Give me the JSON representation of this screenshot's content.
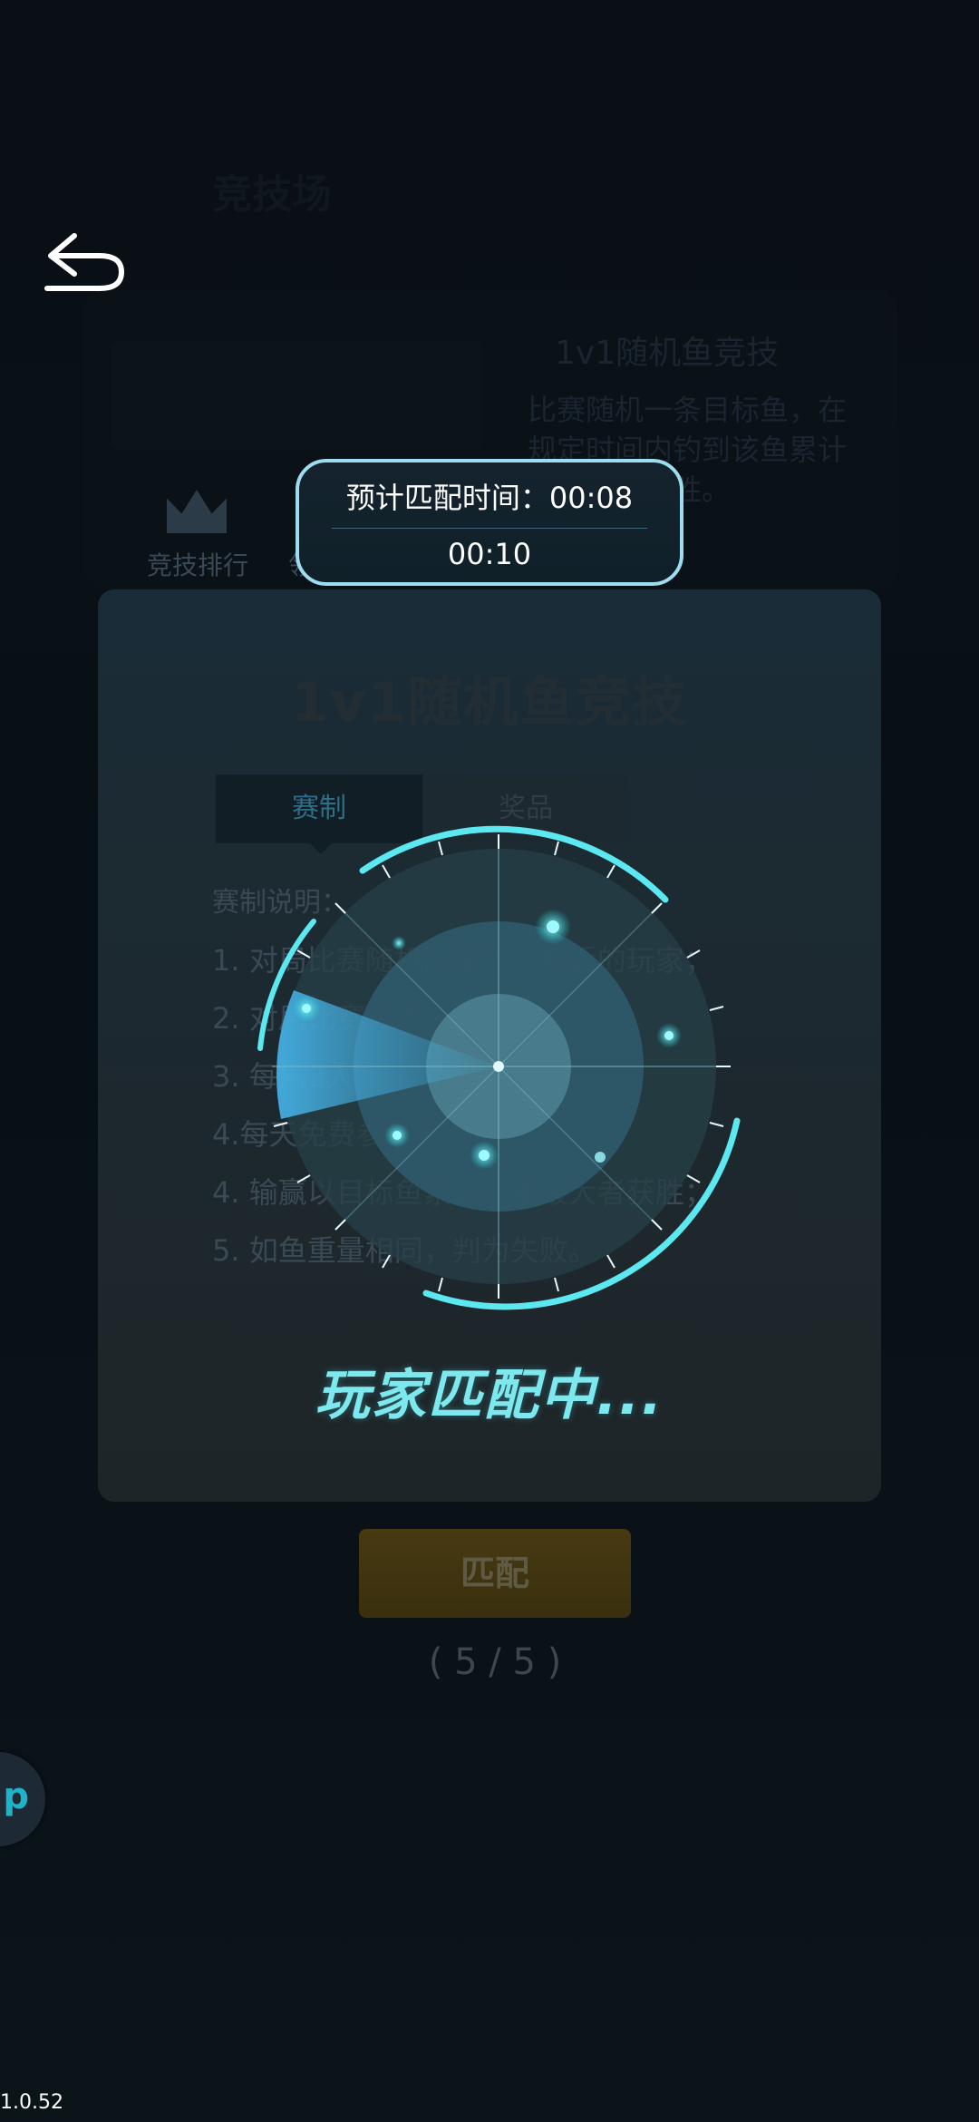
{
  "header": {
    "title": "竞技场"
  },
  "top_card": {
    "title": "1v1随机鱼竞技",
    "description": "比赛随机一条目标鱼，在规定时间内钓到该鱼累计重量大者获胜。",
    "rank_label": "竞技排行",
    "reward_label": "领取奖励"
  },
  "estimate": {
    "label_line": "预计匹配时间：00:08",
    "elapsed": "00:10"
  },
  "modal": {
    "title": "1v1随机鱼竞技",
    "tabs": [
      "赛制",
      "奖品"
    ],
    "rules_heading": "赛制说明：",
    "rules": [
      "1. 对局比赛随机匹配水平相近的玩家；",
      "2. 对局比赛每场5分钟；",
      "3. 每局2人参与；",
      "4.每天免费参与5次；",
      "4. 输赢以目标鱼累计鱼重最大者获胜；",
      "5. 如鱼重量相同，判为失败。"
    ]
  },
  "matching_status": "玩家匹配中...",
  "match_button": {
    "label": "匹配",
    "count": "( 5 / 5 )"
  },
  "float_button": {
    "label": "up"
  },
  "version": "1.0.52",
  "colors": {
    "accent_cyan": "#5ce8f0",
    "bubble_border": "#9edcef",
    "match_button_gold": "#473a12"
  },
  "icons": {
    "back": "back-arrow-icon",
    "rank": "crown-icon",
    "reward": "gift-icon"
  }
}
